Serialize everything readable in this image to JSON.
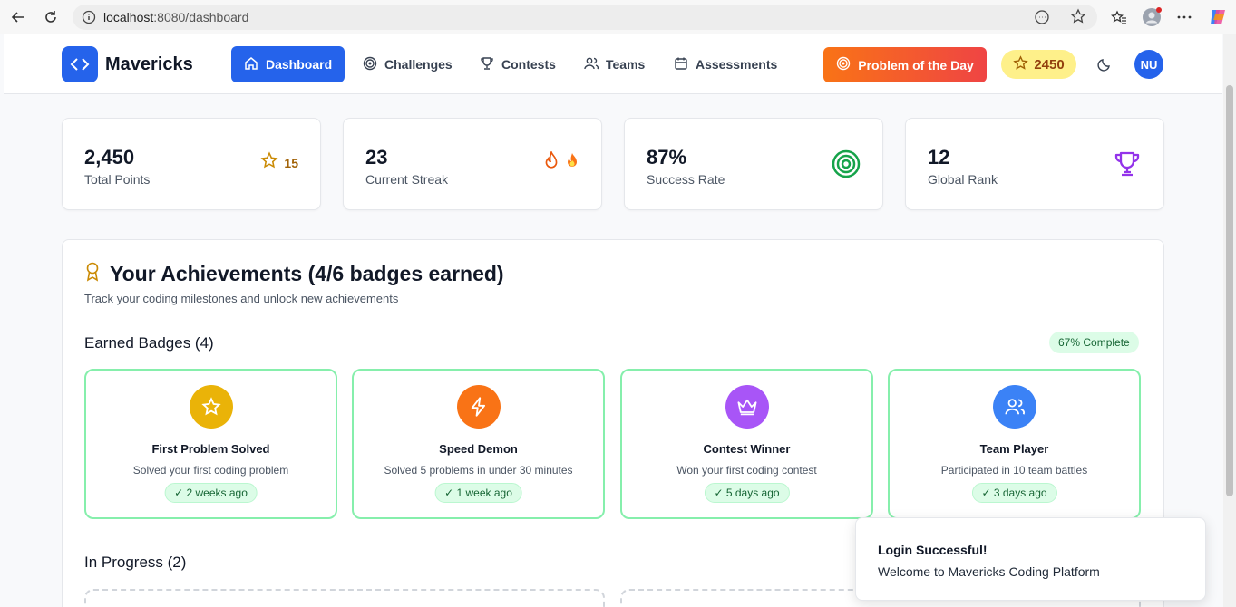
{
  "browser": {
    "url_host": "localhost",
    "url_path": ":8080/dashboard"
  },
  "nav": {
    "brand": "Mavericks",
    "items": [
      {
        "label": "Dashboard",
        "icon": "home-icon",
        "active": true
      },
      {
        "label": "Challenges",
        "icon": "target-icon",
        "active": false
      },
      {
        "label": "Contests",
        "icon": "trophy-icon",
        "active": false
      },
      {
        "label": "Teams",
        "icon": "users-icon",
        "active": false
      },
      {
        "label": "Assessments",
        "icon": "calendar-icon",
        "active": false
      }
    ],
    "potd_label": "Problem of the Day",
    "points": "2450",
    "avatar_initials": "NU"
  },
  "stats": [
    {
      "value": "2,450",
      "label": "Total Points",
      "extra": "15",
      "icon": "star-icon",
      "color": "#ca8a04"
    },
    {
      "value": "23",
      "label": "Current Streak",
      "extra": "",
      "icon": "flame-icon",
      "color": "#ea580c"
    },
    {
      "value": "87%",
      "label": "Success Rate",
      "extra": "",
      "icon": "target-icon",
      "color": "#16a34a"
    },
    {
      "value": "12",
      "label": "Global Rank",
      "extra": "",
      "icon": "trophy-icon",
      "color": "#9333ea"
    }
  ],
  "achievements": {
    "title": "Your Achievements (4/6 badges earned)",
    "subtitle": "Track your coding milestones and unlock new achievements",
    "earned_heading": "Earned Badges (4)",
    "complete": "67% Complete",
    "badges": [
      {
        "name": "First Problem Solved",
        "desc": "Solved your first coding problem",
        "time": "✓ 2 weeks ago",
        "icon": "star-icon",
        "color": "#eab308"
      },
      {
        "name": "Speed Demon",
        "desc": "Solved 5 problems in under 30 minutes",
        "time": "✓ 1 week ago",
        "icon": "lightning-icon",
        "color": "#f97316"
      },
      {
        "name": "Contest Winner",
        "desc": "Won your first coding contest",
        "time": "✓ 5 days ago",
        "icon": "crown-icon",
        "color": "#a855f7"
      },
      {
        "name": "Team Player",
        "desc": "Participated in 10 team battles",
        "time": "✓ 3 days ago",
        "icon": "users-icon",
        "color": "#3b82f6"
      }
    ],
    "in_progress_heading": "In Progress (2)"
  },
  "toast": {
    "title": "Login Successful!",
    "message": "Welcome to Mavericks Coding Platform"
  }
}
